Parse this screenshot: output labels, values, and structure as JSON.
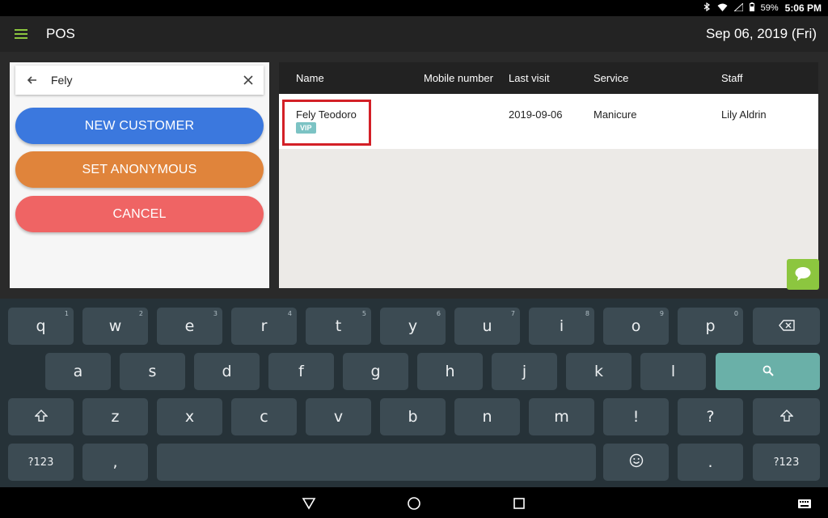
{
  "status_bar": {
    "battery": "59%",
    "time": "5:06 PM",
    "icons": [
      "bluetooth-icon",
      "wifi-icon",
      "signal-icon",
      "battery-icon"
    ]
  },
  "app_bar": {
    "title": "POS",
    "date": "Sep 06, 2019 (Fri)"
  },
  "search": {
    "value": "Fely"
  },
  "buttons": {
    "new_customer": "NEW CUSTOMER",
    "set_anonymous": "SET ANONYMOUS",
    "cancel": "CANCEL"
  },
  "table": {
    "headers": {
      "name": "Name",
      "mobile": "Mobile number",
      "last_visit": "Last visit",
      "service": "Service",
      "staff": "Staff"
    },
    "rows": [
      {
        "name": "Fely Teodoro",
        "badge": "VIP",
        "mobile": "",
        "last_visit": "2019-09-06",
        "service": "Manicure",
        "staff": "Lily Aldrin"
      }
    ]
  },
  "keyboard": {
    "row1": [
      "q",
      "w",
      "e",
      "r",
      "t",
      "y",
      "u",
      "i",
      "o",
      "p"
    ],
    "row1_hints": [
      "1",
      "2",
      "3",
      "4",
      "5",
      "6",
      "7",
      "8",
      "9",
      "0"
    ],
    "row2": [
      "a",
      "s",
      "d",
      "f",
      "g",
      "h",
      "j",
      "k",
      "l"
    ],
    "row3": [
      "z",
      "x",
      "c",
      "v",
      "b",
      "n",
      "m",
      "!",
      "?"
    ],
    "sym_label": "?123",
    "comma": ",",
    "period": "."
  },
  "colors": {
    "accent_green": "#8cc63f",
    "new_customer_blue": "#3b78de",
    "anonymous_orange": "#e0843b",
    "cancel_red": "#ef6464",
    "vip_teal": "#7cc3c4",
    "highlight_red": "#d32027",
    "keyboard_search": "#6ab0a8"
  }
}
